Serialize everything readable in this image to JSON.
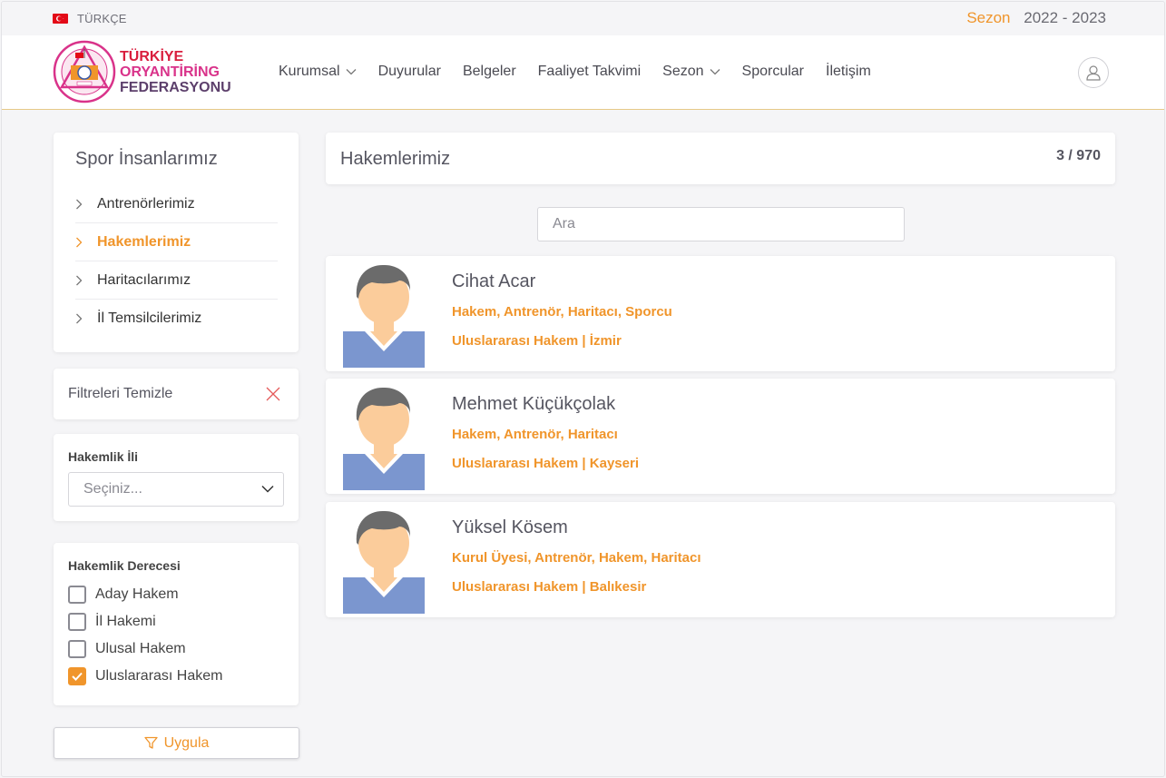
{
  "topbar": {
    "language": "TÜRKÇE",
    "season_label": "Sezon",
    "season_value": "2022 - 2023"
  },
  "logo": {
    "line1": "TÜRKİYE",
    "line2": "ORYANTİRİNG",
    "line3": "FEDERASYONU",
    "colors": [
      "#d91e3d",
      "#d9338a",
      "#5c3f6b"
    ]
  },
  "nav": {
    "items": [
      {
        "label": "Kurumsal",
        "has_dropdown": true
      },
      {
        "label": "Duyurular",
        "has_dropdown": false
      },
      {
        "label": "Belgeler",
        "has_dropdown": false
      },
      {
        "label": "Faaliyet Takvimi",
        "has_dropdown": false
      },
      {
        "label": "Sezon",
        "has_dropdown": true
      },
      {
        "label": "Sporcular",
        "has_dropdown": false
      },
      {
        "label": "İletişim",
        "has_dropdown": false
      }
    ],
    "user_icon": "user-icon"
  },
  "sidebar": {
    "title": "Spor İnsanlarımız",
    "items": [
      {
        "label": "Antrenörlerimiz",
        "active": false
      },
      {
        "label": "Hakemlerimiz",
        "active": true
      },
      {
        "label": "Haritacılarımız",
        "active": false
      },
      {
        "label": "İl Temsilcilerimiz",
        "active": false
      }
    ]
  },
  "filters": {
    "clear_label": "Filtreleri Temizle",
    "city_label": "Hakemlik İli",
    "city_placeholder": "Seçiniz...",
    "grade_label": "Hakemlik Derecesi",
    "grades": [
      {
        "label": "Aday Hakem",
        "checked": false
      },
      {
        "label": "İl Hakemi",
        "checked": false
      },
      {
        "label": "Ulusal Hakem",
        "checked": false
      },
      {
        "label": "Uluslararası Hakem",
        "checked": true
      }
    ],
    "apply_label": "Uygula"
  },
  "main": {
    "title": "Hakemlerimiz",
    "count": "3 / 970",
    "search_placeholder": "Ara",
    "people": [
      {
        "name": "Cihat Acar",
        "roles": "Hakem, Antrenör, Haritacı, Sporcu",
        "detail": "Uluslararası Hakem | İzmir"
      },
      {
        "name": "Mehmet Küçükçolak",
        "roles": "Hakem, Antrenör, Haritacı",
        "detail": "Uluslararası Hakem | Kayseri"
      },
      {
        "name": "Yüksel Kösem",
        "roles": "Kurul Üyesi, Antrenör, Hakem, Haritacı",
        "detail": "Uluslararası Hakem | Balıkesir"
      }
    ]
  },
  "colors": {
    "accent": "#f0952b",
    "header_border": "#e6c987",
    "avatar_shirt": "#7b96cf",
    "avatar_hair": "#6b6b6b",
    "avatar_skin": "#fbcc9b"
  }
}
